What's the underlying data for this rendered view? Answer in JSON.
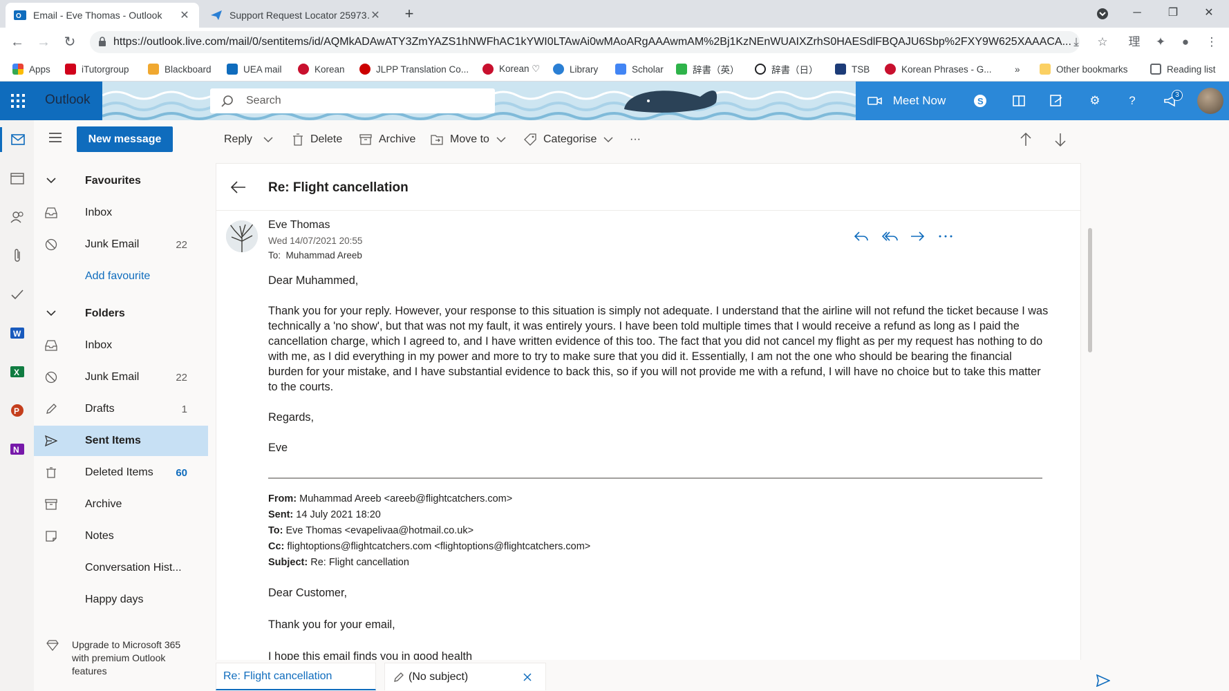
{
  "browser": {
    "tabs": [
      {
        "title": "Email - Eve Thomas - Outlook",
        "active": true
      },
      {
        "title": "Support Request Locator 25973…",
        "active": false
      }
    ],
    "url": "https://outlook.live.com/mail/0/sentitems/id/AQMkADAwATY3ZmYAZS1hNWFhAC1kYWI0LTAwAi0wMAoARgAAAwmAM%2Bj1KzNEnWUAIXZrhS0HAESdlFBQAJU6Sbp%2FXY9W625XAAACA...",
    "bookmarks": [
      "Apps",
      "iTutorgroup",
      "Blackboard",
      "UEA mail",
      "Korean",
      "JLPP Translation Co...",
      "Korean ♡",
      "Library",
      "Scholar",
      "辞書（英）",
      "辞書（日）",
      "TSB",
      "Korean Phrases - G...",
      "»",
      "Other bookmarks",
      "Reading list"
    ]
  },
  "header": {
    "brand": "Outlook",
    "search_placeholder": "Search",
    "meet_now": "Meet Now",
    "notification_count": "3",
    "accent_color": "#0f6cbd"
  },
  "folders": {
    "new_message": "New message",
    "favourites_heading": "Favourites",
    "favourites": [
      {
        "label": "Inbox",
        "count": ""
      },
      {
        "label": "Junk Email",
        "count": "22"
      }
    ],
    "add_favourite": "Add favourite",
    "folders_heading": "Folders",
    "items": [
      {
        "label": "Inbox",
        "count": ""
      },
      {
        "label": "Junk Email",
        "count": "22"
      },
      {
        "label": "Drafts",
        "count": "1"
      },
      {
        "label": "Sent Items",
        "count": ""
      },
      {
        "label": "Deleted Items",
        "count": "60"
      },
      {
        "label": "Archive",
        "count": ""
      },
      {
        "label": "Notes",
        "count": ""
      },
      {
        "label": "Conversation Hist...",
        "count": ""
      },
      {
        "label": "Happy days",
        "count": ""
      }
    ],
    "upgrade_text": "Upgrade to Microsoft 365 with premium Outlook features"
  },
  "commands": {
    "reply": "Reply",
    "delete": "Delete",
    "archive": "Archive",
    "move_to": "Move to",
    "categorise": "Categorise",
    "more": "···"
  },
  "message": {
    "subject": "Re: Flight cancellation",
    "sender": "Eve Thomas",
    "date": "Wed 14/07/2021 20:55",
    "to_label": "To:",
    "to": "Muhammad Areeb",
    "greeting": "Dear Muhammed,",
    "paragraph": "Thank you for your reply. However, your response to this situation is simply not adequate. I understand that the airline will not refund the ticket because I was technically a 'no show', but that was not my fault, it was entirely yours. I have been told multiple times that I would receive a refund as long as I paid the cancellation charge, which I agreed to, and I have written evidence of this too. The fact that you did not cancel my flight as per my request has nothing to do with me, as I did everything in my power and more to try to make sure that you did it. Essentially, I am not the one who should be bearing the financial burden for your mistake, and I have substantial evidence to back this, so if you will not provide me with a refund, I will have no choice but to take this matter to the courts.",
    "signoff": "Regards,",
    "signature": "Eve",
    "quoted": {
      "from_label": "From:",
      "from": "Muhammad Areeb <areeb@flightcatchers.com>",
      "sent_label": "Sent:",
      "sent": "14 July 2021 18:20",
      "to_label": "To:",
      "to": "Eve Thomas <evapelivaa@hotmail.co.uk>",
      "cc_label": "Cc:",
      "cc": "flightoptions@flightcatchers.com <flightoptions@flightcatchers.com>",
      "subject_label": "Subject:",
      "subject": "Re: Flight cancellation",
      "greeting": "Dear Customer,",
      "line1": "Thank you for your email,",
      "line2": "I hope this email finds you in good health"
    }
  },
  "bottom_tabs": [
    {
      "label": "Re: Flight cancellation"
    },
    {
      "label": "(No subject)"
    }
  ]
}
